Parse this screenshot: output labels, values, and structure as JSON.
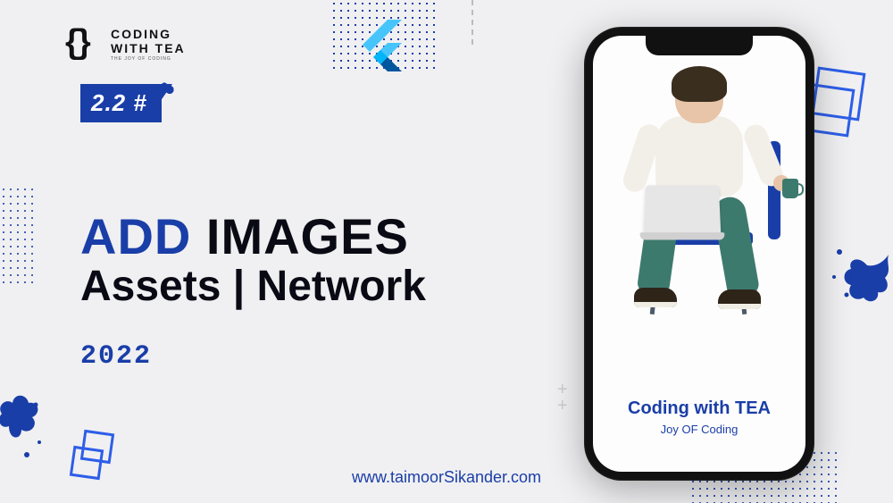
{
  "logo": {
    "line1": "CODING",
    "line2": "WITH TEA",
    "tagline": "THE JOY OF CODING"
  },
  "badge": "2.2 #",
  "headline": {
    "accent": "ADD",
    "main": "IMAGES",
    "sub": "Assets | Network"
  },
  "year": "2022",
  "url": "www.taimoorSikander.com",
  "phone": {
    "title": "Coding with TEA",
    "subtitle": "Joy OF Coding"
  },
  "colors": {
    "primary": "#1a3ea8",
    "teal": "#3d7a6e",
    "dark": "#0a0a14"
  }
}
